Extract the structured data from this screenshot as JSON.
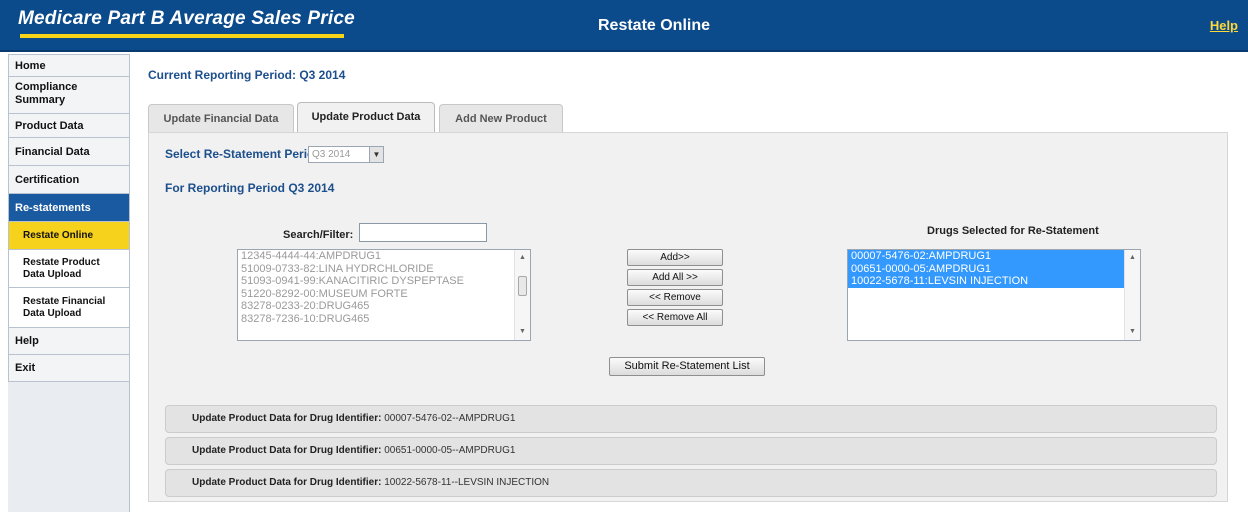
{
  "header": {
    "brand": "Medicare Part B Average Sales Price",
    "title": "Restate Online",
    "help": "Help",
    "colors": {
      "bar": "#0b4a8b",
      "accent": "#f7d417"
    }
  },
  "sidebar": {
    "items": [
      {
        "label": "Home"
      },
      {
        "label": "Compliance Summary"
      },
      {
        "label": "Product Data"
      },
      {
        "label": "Financial Data"
      },
      {
        "label": "Certification"
      },
      {
        "label": "Re-statements"
      }
    ],
    "subitems": [
      {
        "label": "Restate Online"
      },
      {
        "label": "Restate Product Data Upload"
      },
      {
        "label": "Restate Financial Data Upload"
      }
    ],
    "after": [
      {
        "label": "Help"
      },
      {
        "label": "Exit"
      }
    ]
  },
  "main": {
    "period_title": "Current Reporting Period: Q3 2014",
    "tabs": [
      {
        "label": "Update Financial Data"
      },
      {
        "label": "Update Product Data"
      },
      {
        "label": "Add New Product"
      }
    ],
    "restatement_label": "Select Re-Statement Period:",
    "restatement_value": "Q3 2014",
    "reporting_label": "For Reporting Period Q3 2014",
    "search_label": "Search/Filter:",
    "search_value": "",
    "available_drugs": [
      "12345-4444-44:AMPDRUG1",
      "51009-0733-82:LINA HYDRCHLORIDE",
      "51093-0941-99:KANACITIRIC DYSPEPTASE",
      "51220-8292-00:MUSEUM FORTE",
      "83278-0233-20:DRUG465",
      "83278-7236-10:DRUG465"
    ],
    "buttons": {
      "add": "Add>>",
      "add_all": "Add All >>",
      "remove": "<< Remove",
      "remove_all": "<< Remove All",
      "submit": "Submit Re-Statement List"
    },
    "selected_label": "Drugs Selected for Re-Statement",
    "selected_drugs": [
      "00007-5476-02:AMPDRUG1",
      "00651-0000-05:AMPDRUG1",
      "10022-5678-11:LEVSIN INJECTION"
    ],
    "accordion_prefix": "Update Product Data for Drug Identifier:",
    "accordion_items": [
      "00007-5476-02--AMPDRUG1",
      "00651-0000-05--AMPDRUG1",
      "10022-5678-11--LEVSIN INJECTION"
    ]
  }
}
